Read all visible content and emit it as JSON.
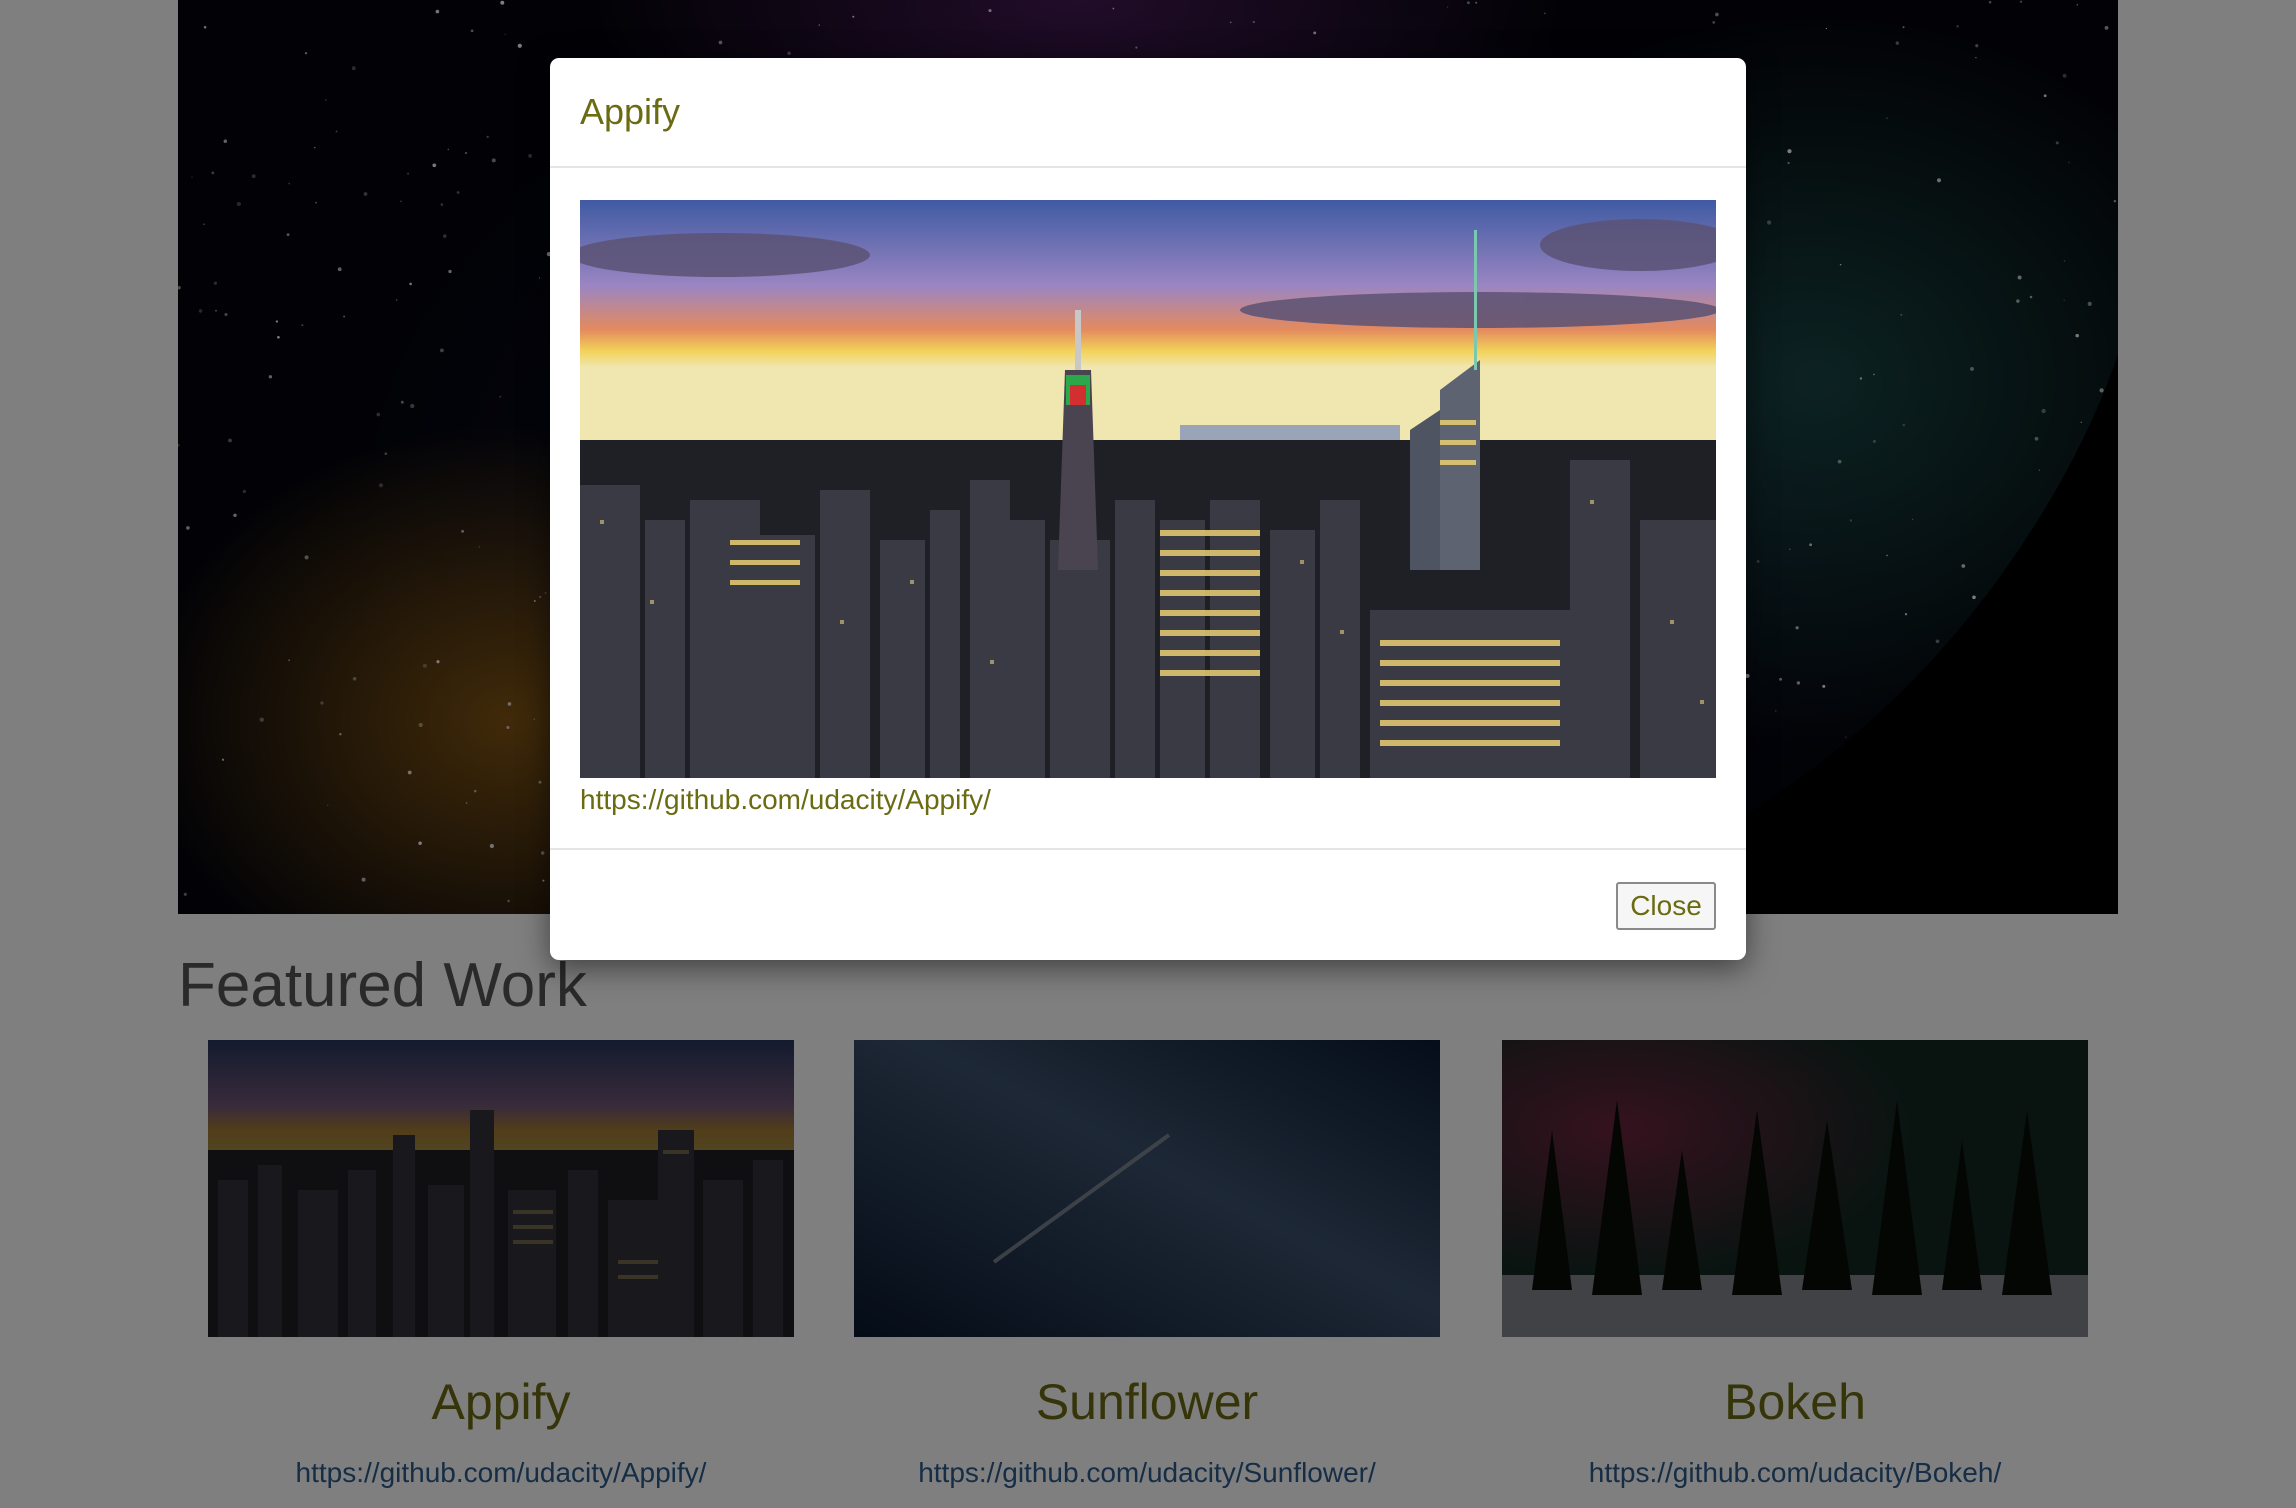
{
  "page": {
    "featured_title": "Featured Work",
    "cards": [
      {
        "title": "Appify",
        "link": "https://github.com/udacity/Appify/",
        "image": "city-skyline-thumbnail"
      },
      {
        "title": "Sunflower",
        "link": "https://github.com/udacity/Sunflower/",
        "image": "milky-way-thumbnail"
      },
      {
        "title": "Bokeh",
        "link": "https://github.com/udacity/Bokeh/",
        "image": "aurora-forest-thumbnail"
      }
    ]
  },
  "modal": {
    "title": "Appify",
    "image": "city-skyline-image",
    "link": "https://github.com/udacity/Appify/",
    "close_label": "Close"
  },
  "colors": {
    "accent_text": "#6b6b12",
    "link_blue": "#2c5a8c",
    "backdrop": "rgba(0,0,0,0.5)"
  }
}
